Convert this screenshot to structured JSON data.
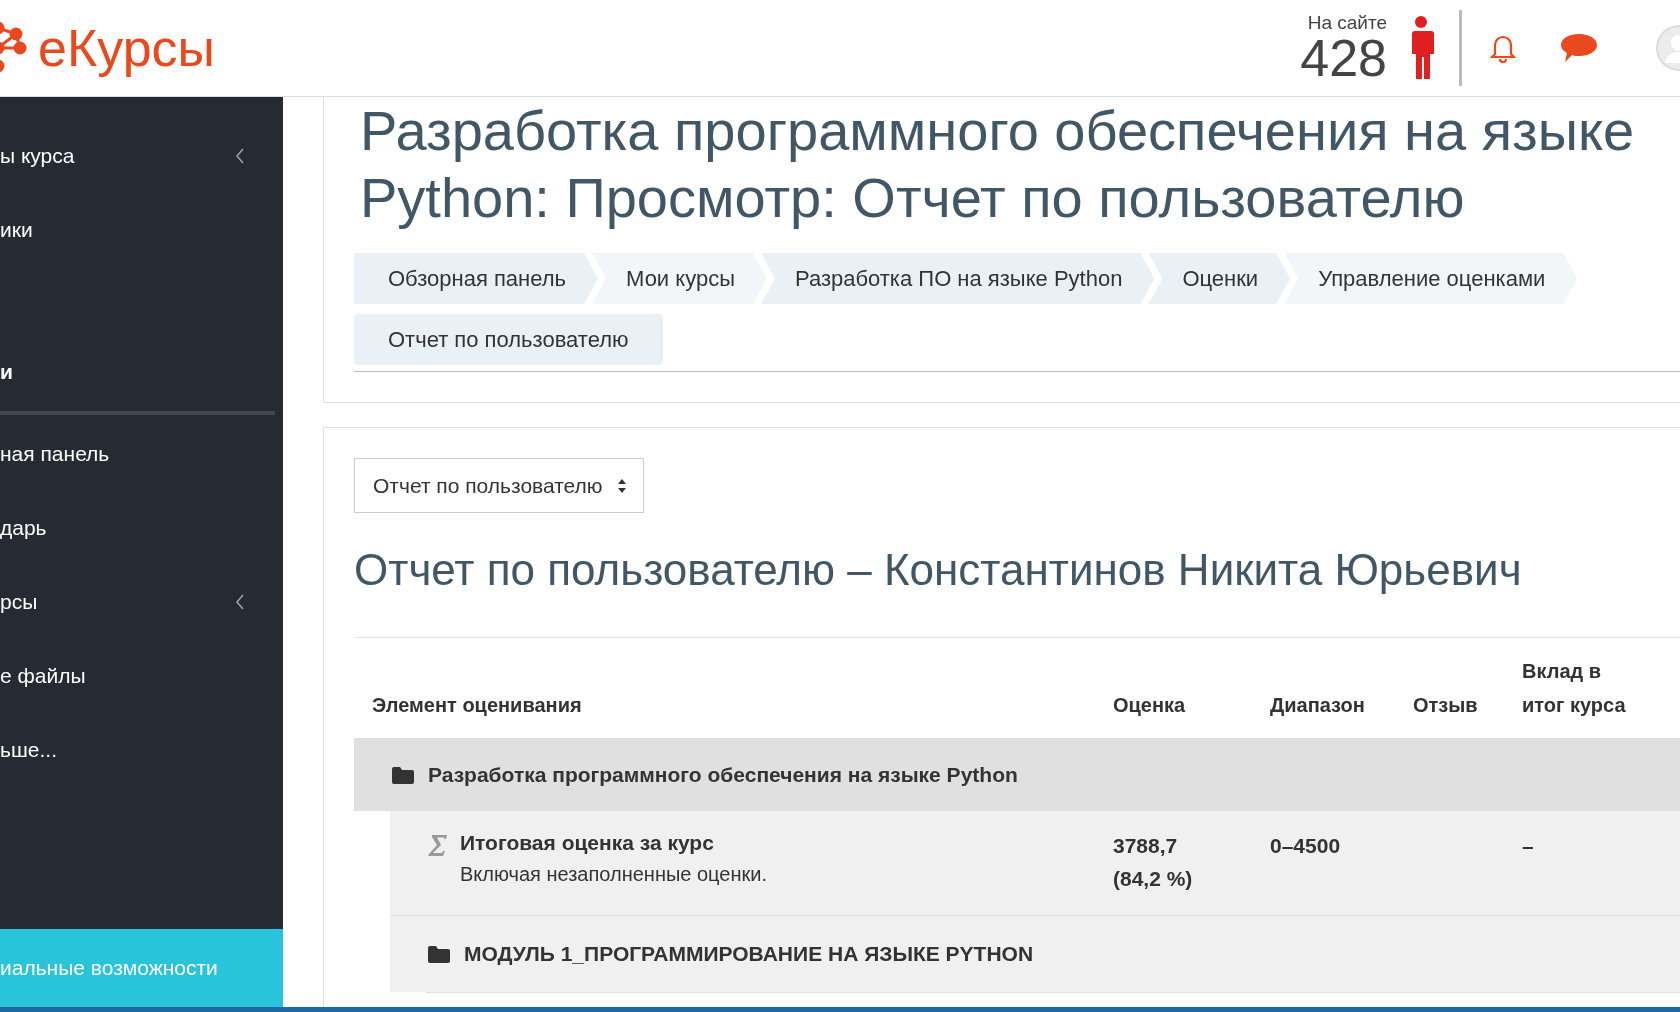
{
  "header": {
    "logo": "еКурсы",
    "online_label": "На сайте",
    "online_count": "428"
  },
  "sidebar": {
    "items": [
      {
        "label": "ы курса",
        "kind": "item",
        "chevron": true
      },
      {
        "label": "ики",
        "kind": "item",
        "chevron": false
      },
      {
        "label": "и",
        "kind": "section"
      },
      {
        "label": "ная панель",
        "kind": "item",
        "chevron": false
      },
      {
        "label": "дарь",
        "kind": "item",
        "chevron": false
      },
      {
        "label": "рсы",
        "kind": "item",
        "chevron": true
      },
      {
        "label": "е файлы",
        "kind": "item",
        "chevron": false
      },
      {
        "label": "ьше...",
        "kind": "item",
        "chevron": false
      }
    ],
    "bottom_button": "иальные возможности"
  },
  "page_title": "Разработка программного обеспечения на языке Python: Просмотр: Отчет по пользователю",
  "breadcrumbs": [
    {
      "label": "Обзорная панель",
      "color": "#e9f1f6"
    },
    {
      "label": "Мои курсы",
      "color": "#f3f6f8"
    },
    {
      "label": "Разработка ПО на языке Python",
      "color": "#e9f1f6"
    },
    {
      "label": "Оценки",
      "color": "#e9f1f6"
    },
    {
      "label": "Управление оценками",
      "color": "#f3f6f8"
    },
    {
      "label": "Отчет по пользователю",
      "color": "#e9f1f6"
    }
  ],
  "report_select": {
    "value": "Отчет по пользователю"
  },
  "report_heading": "Отчет по пользователю – Константинов Никита Юрьевич",
  "table": {
    "columns": [
      "Элемент оценивания",
      "Оценка",
      "Диапазон",
      "Отзыв",
      "Вклад в итог курса"
    ],
    "rows": [
      {
        "kind": "category",
        "label": "Разработка программного обеспечения на языке Python"
      },
      {
        "kind": "total",
        "label": "Итоговая оценка за курс",
        "note": "Включая незаполненные оценки.",
        "grade": "3788,7 (84,2 %)",
        "range": "0–4500",
        "contribution": "–"
      },
      {
        "kind": "subcategory",
        "label": "МОДУЛЬ 1_ПРОГРАММИРОВАНИЕ НА ЯЗЫКЕ PYTHON"
      }
    ]
  }
}
